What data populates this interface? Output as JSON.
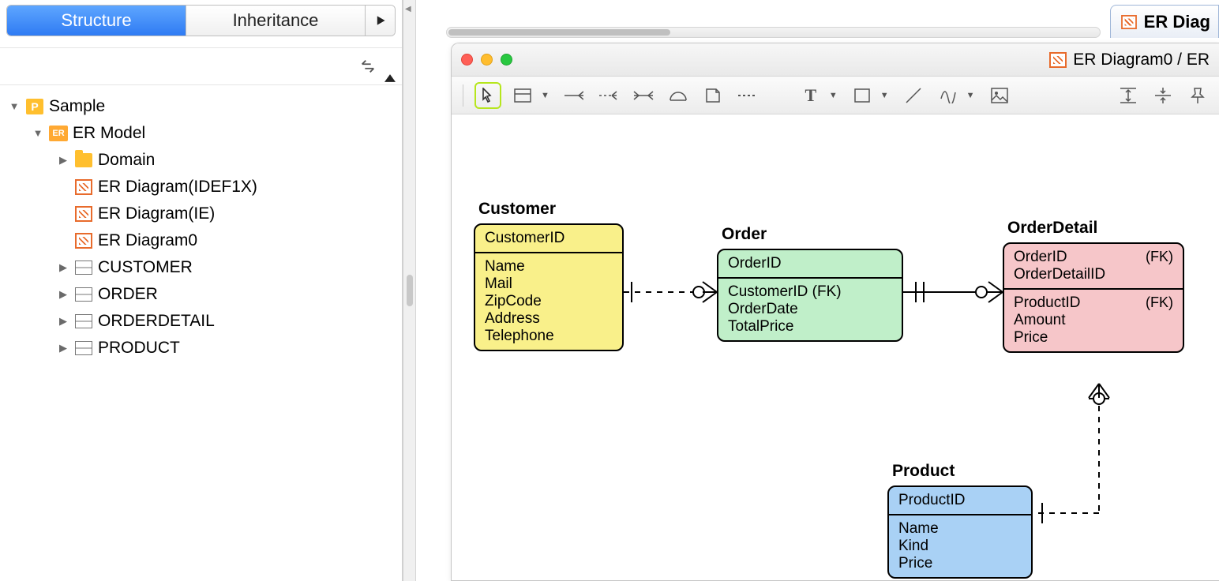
{
  "sidebar": {
    "tabs": {
      "structure": "Structure",
      "inheritance": "Inheritance"
    },
    "root": "Sample",
    "ermodel": "ER Model",
    "domain": "Domain",
    "diag_idef1x": "ER Diagram(IDEF1X)",
    "diag_ie": "ER Diagram(IE)",
    "diag0": "ER Diagram0",
    "tbl_customer": "CUSTOMER",
    "tbl_order": "ORDER",
    "tbl_orderdetail": "ORDERDETAIL",
    "tbl_product": "PRODUCT"
  },
  "doc_tab": "ER Diag",
  "win_title": "ER Diagram0 / ER",
  "fk_label": "(FK)",
  "entities": {
    "customer": {
      "name": "Customer",
      "pk": "CustomerID",
      "attrs": [
        "Name",
        "Mail",
        "ZipCode",
        "Address",
        "Telephone"
      ]
    },
    "order": {
      "name": "Order",
      "pk": "OrderID",
      "attrs": [
        "CustomerID (FK)",
        "OrderDate",
        "TotalPrice"
      ]
    },
    "orderdetail": {
      "name": "OrderDetail",
      "pk1": "OrderID",
      "pk2": "OrderDetailID",
      "attr1": "ProductID",
      "attrs": [
        "Amount",
        "Price"
      ]
    },
    "product": {
      "name": "Product",
      "pk": "ProductID",
      "attrs": [
        "Name",
        "Kind",
        "Price"
      ]
    }
  }
}
